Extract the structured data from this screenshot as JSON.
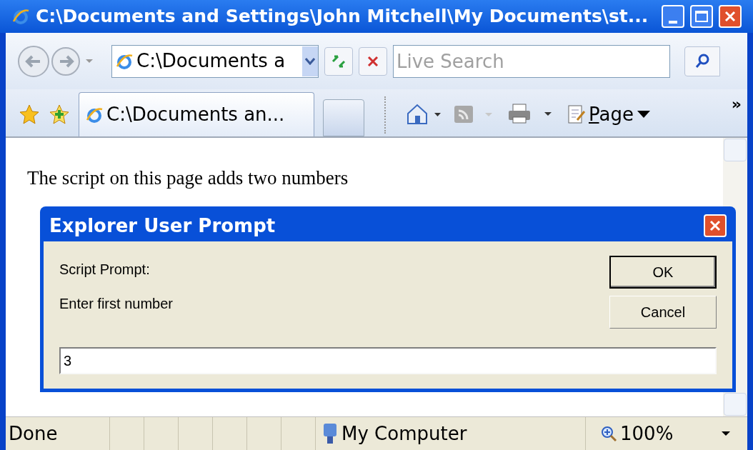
{
  "window": {
    "title": "C:\\Documents and Settings\\John Mitchell\\My Documents\\st..."
  },
  "address_bar": {
    "value": "C:\\Documents a"
  },
  "search": {
    "placeholder": "Live Search"
  },
  "tabs": [
    {
      "label": "C:\\Documents an...",
      "selected": true
    }
  ],
  "command_bar": {
    "page_menu": "Page",
    "overflow": "»"
  },
  "page": {
    "text": "The script on this page adds two numbers"
  },
  "dialog": {
    "title": "Explorer User Prompt",
    "label": "Script Prompt:",
    "message": "Enter first number",
    "value": "3",
    "buttons": [
      {
        "label": "OK",
        "default": true
      },
      {
        "label": "Cancel",
        "default": false
      }
    ]
  },
  "status_bar": {
    "text": "Done",
    "zone": "My Computer",
    "zoom": "100%"
  }
}
